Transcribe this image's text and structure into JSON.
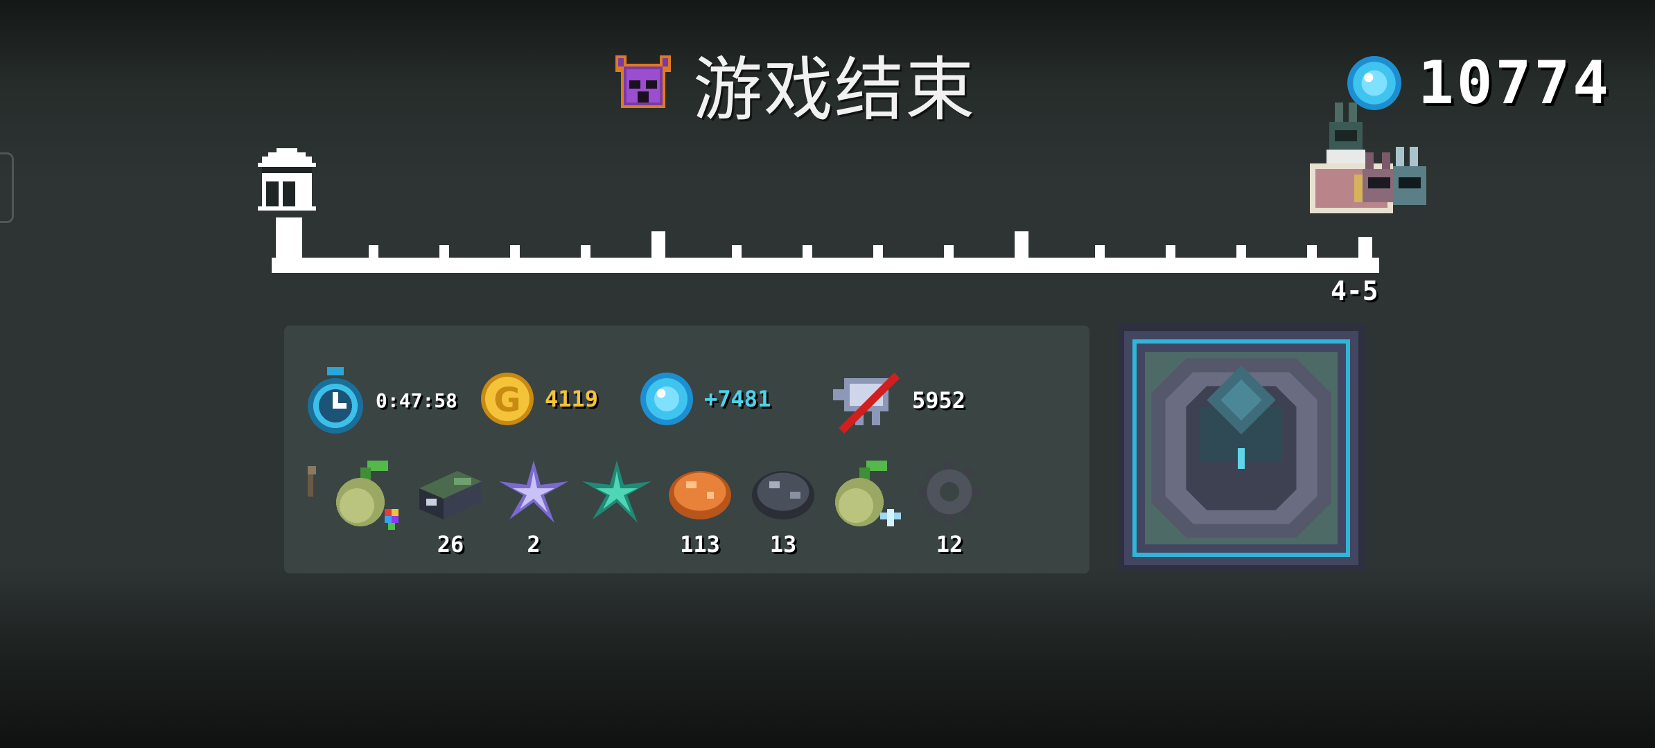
{
  "header": {
    "title": "游戏结束",
    "title_icon": "purple-demon-mask-icon"
  },
  "gems_total": {
    "icon": "blue-gem-icon",
    "value": "10774"
  },
  "progress": {
    "stage_label": "4-5",
    "start_icon": "home-icon",
    "player_icon": "player-party-icon"
  },
  "stats": {
    "time": {
      "icon": "stopwatch-icon",
      "value": "0:47:58"
    },
    "gold": {
      "icon": "gold-coin-icon",
      "value": "4119",
      "color": "#f5c33a"
    },
    "gems": {
      "icon": "blue-gem-icon",
      "value": "+7481",
      "color": "#4fd3ec"
    },
    "kills": {
      "icon": "slain-enemy-icon",
      "value": "5952"
    }
  },
  "items": [
    {
      "icon": "small-stick-icon",
      "count": ""
    },
    {
      "icon": "seed-pod-rainbow-flower-icon",
      "count": ""
    },
    {
      "icon": "battery-box-icon",
      "count": "26"
    },
    {
      "icon": "purple-crystal-star-icon",
      "count": "2"
    },
    {
      "icon": "green-leaf-star-icon",
      "count": ""
    },
    {
      "icon": "orange-ore-icon",
      "count": "113"
    },
    {
      "icon": "dark-iron-ore-icon",
      "count": "13"
    },
    {
      "icon": "seed-pod-ice-flower-icon",
      "count": ""
    },
    {
      "icon": "gear-icon",
      "count": "12"
    }
  ],
  "portal": {
    "icon": "portal-altar-icon"
  },
  "colors": {
    "panel": "#3a4443",
    "gold_text": "#f5c33a",
    "gem_text": "#4fd3ec",
    "portal_frame": "#2fb6d8"
  }
}
